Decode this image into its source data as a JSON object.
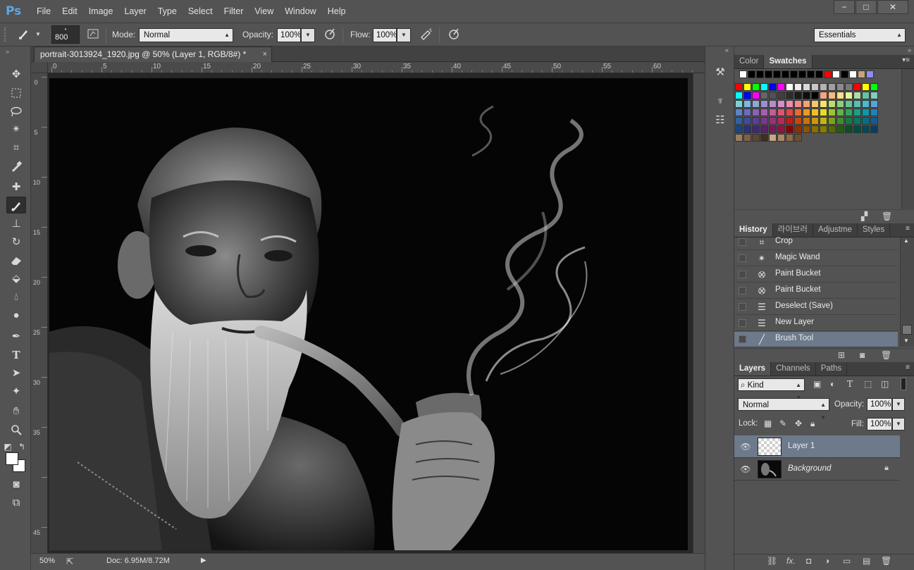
{
  "app": {
    "logo": "Ps"
  },
  "menu": [
    "File",
    "Edit",
    "Image",
    "Layer",
    "Type",
    "Select",
    "Filter",
    "View",
    "Window",
    "Help"
  ],
  "window_controls": {
    "minimize": "−",
    "maximize": "□",
    "close": "✕"
  },
  "options": {
    "brush_size": "800",
    "mode_label": "Mode:",
    "mode_value": "Normal",
    "opacity_label": "Opacity:",
    "opacity_value": "100%",
    "flow_label": "Flow:",
    "flow_value": "100%",
    "workspace": "Essentials"
  },
  "document": {
    "tab_title": "portrait-3013924_1920.jpg @ 50% (Layer 1, RGB/8#) *",
    "tab_close": "×",
    "ruler_top_labels": [
      "0",
      "5",
      "10",
      "15",
      "20",
      "25",
      "30",
      "35",
      "40",
      "45",
      "50",
      "55",
      "60"
    ],
    "ruler_left_labels": [
      "0",
      "5",
      "10",
      "15",
      "20",
      "25",
      "30",
      "35",
      "45"
    ]
  },
  "status": {
    "zoom": "50%",
    "doc_info": "Doc: 6.95M/8.72M"
  },
  "swatches_panel": {
    "tabs": [
      "Color",
      "Swatches"
    ],
    "active_tab": "Swatches",
    "top_row": [
      "#ffffff",
      "#000000",
      "#000000",
      "#000000",
      "#000000",
      "#000000",
      "#000000",
      "#000000",
      "#000000",
      "#000000",
      "#ff0000",
      "#ffffff",
      "#000000",
      "#ffffff",
      "#c8a47c",
      "#8c8cff"
    ],
    "grid": [
      [
        "#ff0000",
        "#ffff00",
        "#00ff00",
        "#00ffff",
        "#0000ff",
        "#ff00ff",
        "#ffffff",
        "#ececec",
        "#d9d9d9",
        "#c6c6c6",
        "#b3b3b3",
        "#9f9f9f",
        "#8c8c8c",
        "#797979",
        "#ff0000",
        "#ffff00",
        "#00ff00"
      ],
      [
        "#00ffff",
        "#0000ff",
        "#ff00ff",
        "#666666",
        "#525252",
        "#3f3f3f",
        "#2c2c2c",
        "#1a1a1a",
        "#0d0d0d",
        "#000000",
        "#f4a582",
        "#fdb97d",
        "#fce08a",
        "#e6f598",
        "#abdda4",
        "#66c2a5",
        "#80cdc1"
      ],
      [
        "#7ecfd4",
        "#7bb6e6",
        "#8ea6d8",
        "#9b8fcf",
        "#b58dd1",
        "#d68dca",
        "#ef8bb0",
        "#f48a8a",
        "#f4a36b",
        "#f7c46a",
        "#f3e46b",
        "#b9dd6c",
        "#86d27a",
        "#63c692",
        "#55c0b3",
        "#4eb7cf",
        "#57a3dc"
      ],
      [
        "#5a83c9",
        "#6a6dbb",
        "#8a61b4",
        "#a85eaf",
        "#c65a9b",
        "#e05273",
        "#e64545",
        "#e76b2e",
        "#ed9927",
        "#f1c01f",
        "#e5df24",
        "#9ac730",
        "#5db543",
        "#2ea75c",
        "#15a287",
        "#0c98a9",
        "#1c82bd"
      ],
      [
        "#2b63a9",
        "#3f4b9e",
        "#5c3e96",
        "#7a368f",
        "#99307b",
        "#b7285a",
        "#c21a1a",
        "#c4480f",
        "#c9730b",
        "#ce9805",
        "#c2b80a",
        "#7ca219",
        "#3e8f2b",
        "#137d40",
        "#047965",
        "#027084",
        "#0d5d96"
      ],
      [
        "#1a4486",
        "#2a327c",
        "#402874",
        "#5a1f6d",
        "#76195c",
        "#911341",
        "#8b0000",
        "#8b3300",
        "#8b5400",
        "#8b6e00",
        "#857d00",
        "#526b00",
        "#245c12",
        "#0a4f25",
        "#024d40",
        "#024a57",
        "#0a3d66"
      ],
      [
        "#9b7e62",
        "#7c6148",
        "#5e4633",
        "#3f2f22",
        "#c9a884",
        "#aa8864",
        "#8a6b4a",
        "#6c4f32"
      ]
    ]
  },
  "history_panel": {
    "tabs": [
      "History",
      "라이브러",
      "Adjustme",
      "Styles"
    ],
    "active_tab": "History",
    "items": [
      {
        "label": "Crop",
        "icon": "crop-icon",
        "glyph": "⌗"
      },
      {
        "label": "Magic Wand",
        "icon": "magic-wand-icon",
        "glyph": "✴"
      },
      {
        "label": "Paint Bucket",
        "icon": "paint-bucket-icon",
        "glyph": "⭙"
      },
      {
        "label": "Paint Bucket",
        "icon": "paint-bucket-icon",
        "glyph": "⭙"
      },
      {
        "label": "Deselect (Save)",
        "icon": "document-icon",
        "glyph": "☰"
      },
      {
        "label": "New Layer",
        "icon": "document-icon",
        "glyph": "☰"
      },
      {
        "label": "Brush Tool",
        "icon": "brush-icon",
        "glyph": "╱"
      }
    ],
    "selected_index": 6
  },
  "layers_panel": {
    "tabs": [
      "Layers",
      "Channels",
      "Paths"
    ],
    "active_tab": "Layers",
    "filter_kind": "Kind",
    "blend_mode": "Normal",
    "opacity_label": "Opacity:",
    "opacity_value": "100%",
    "lock_label": "Lock:",
    "fill_label": "Fill:",
    "fill_value": "100%",
    "layers": [
      {
        "name": "Layer 1",
        "selected": true,
        "locked": false
      },
      {
        "name": "Background",
        "selected": false,
        "locked": true
      }
    ]
  },
  "colors": {
    "accent_selection": "#6c7a8b",
    "ps_logo": "#5aa7e8",
    "panel_bg": "#535353",
    "canvas_bg": "#282828"
  }
}
